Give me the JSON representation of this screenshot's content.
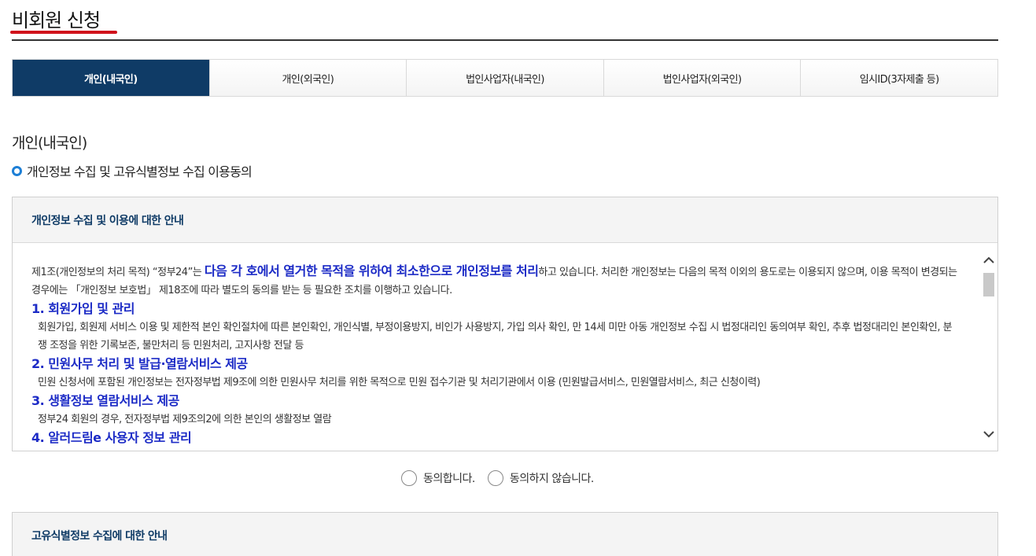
{
  "page": {
    "title": "비회원 신청"
  },
  "tabs": [
    {
      "label": "개인(내국인)",
      "active": true
    },
    {
      "label": "개인(외국인)"
    },
    {
      "label": "법인사업자(내국인)"
    },
    {
      "label": "법인사업자(외국인)"
    },
    {
      "label": "임시ID(3자제출 등)"
    }
  ],
  "section": {
    "title": "개인(내국인)",
    "subtitle": "개인정보 수집 및 고유식별정보 수집 이용동의"
  },
  "privacy_box": {
    "header": "개인정보 수집 및 이용에 대한 안내",
    "intro_1": "제1조(개인정보의 처리 목적) “정부24”는 ",
    "intro_highlight": "다음 각 호에서 열거한 목적을 위하여 최소한으로 개인정보를 처리",
    "intro_2": "하고 있습니다. 처리한 개인정보는 다음의 목적 이외의 용도로는 이용되지 않으며, 이용 목적이 변경되는 경우에는 「개인정보 보호법」 제18조에 따라 별도의 동의를 받는 등 필요한 조치를 이행하고 있습니다.",
    "items": [
      {
        "heading": "1. 회원가입 및 관리",
        "body": "회원가입, 회원제 서비스 이용 및 제한적 본인 확인절차에 따른 본인확인, 개인식별, 부정이용방지, 비인가 사용방지, 가입 의사 확인, 만 14세 미만 아동 개인정보 수집 시 법정대리인 동의여부 확인, 추후 법정대리인 본인확인, 분쟁 조정을 위한 기록보존, 불만처리 등 민원처리, 고지사항 전달 등"
      },
      {
        "heading": "2. 민원사무 처리 및 발급·열람서비스 제공",
        "body": "민원 신청서에 포함된 개인정보는 전자정부법 제9조에 의한 민원사무 처리를 위한 목적으로 민원 접수기관 및 처리기관에서 이용 (민원발급서비스, 민원열람서비스, 최근 신청이력)"
      },
      {
        "heading": "3. 생활정보 열람서비스 제공",
        "body": "정부24 회원의 경우, 전자정부법 제9조의2에 의한 본인의 생활정보 열람"
      },
      {
        "heading": "4. 알러드림e 사용자 정보 관리",
        "body": ""
      }
    ]
  },
  "agree": {
    "yes": "동의합니다.",
    "no": "동의하지 않습니다."
  },
  "unique_id_box": {
    "header": "고유식별정보 수집에 대한 안내"
  }
}
